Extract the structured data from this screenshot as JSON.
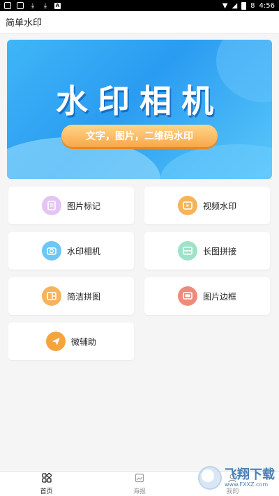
{
  "status_bar": {
    "time": "4:56",
    "battery": "8"
  },
  "app_bar": {
    "title": "简单水印"
  },
  "banner": {
    "title": "水印相机",
    "subtitle": "文字，图片，二维码水印"
  },
  "features": [
    {
      "label": "图片标记",
      "icon": "tag-icon",
      "color": "#e3c4f5"
    },
    {
      "label": "视频水印",
      "icon": "video-icon",
      "color": "#f6b45a"
    },
    {
      "label": "水印相机",
      "icon": "camera-icon",
      "color": "#6cc6f6"
    },
    {
      "label": "长图拼接",
      "icon": "long-image-icon",
      "color": "#9ee3c7"
    },
    {
      "label": "简洁拼图",
      "icon": "collage-icon",
      "color": "#f6b45a"
    },
    {
      "label": "图片边框",
      "icon": "frame-icon",
      "color": "#f08a7a"
    },
    {
      "label": "微辅助",
      "icon": "send-icon",
      "color": "#f5a43c"
    }
  ],
  "bottom_nav": [
    {
      "label": "首页",
      "icon": "home-grid-icon",
      "active": true
    },
    {
      "label": "海报",
      "icon": "poster-icon",
      "active": false
    },
    {
      "label": "我的",
      "icon": "profile-icon",
      "active": false
    }
  ],
  "watermark": {
    "brand": "飞翔下载",
    "url": "www.FXXZ.com"
  }
}
